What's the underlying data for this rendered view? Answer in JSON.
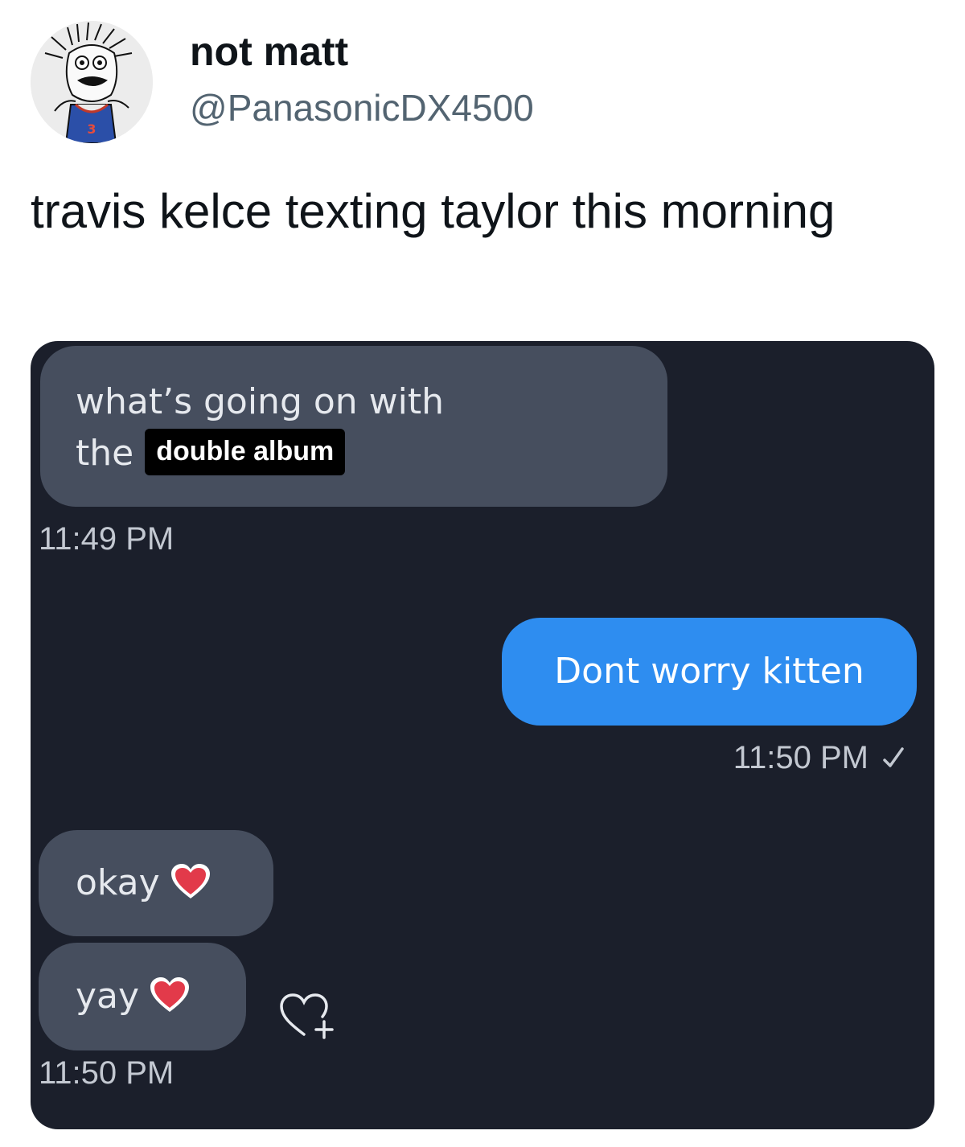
{
  "tweet": {
    "display_name": "not matt",
    "handle": "@PanasonicDX4500",
    "text": "travis kelce texting taylor this morning",
    "avatar_icon": "sketch-avatar-icon"
  },
  "chat": {
    "background": "#1b1f2b",
    "incoming_bubble_color": "#464e5e",
    "outgoing_bubble_color": "#2e8df0",
    "messages": [
      {
        "direction": "incoming",
        "line1": "what’s going on with",
        "line2_prefix": "the",
        "overlay_label": "double album",
        "time": "11:49 PM"
      },
      {
        "direction": "outgoing",
        "text": "Dont worry kitten",
        "time": "11:50 PM",
        "status_icon": "check-icon"
      },
      {
        "direction": "incoming",
        "text": "okay",
        "emoji": "red-heart-icon"
      },
      {
        "direction": "incoming",
        "text": "yay",
        "emoji": "red-heart-icon",
        "time": "11:50 PM",
        "reaction_icon": "add-reaction-heart-icon"
      }
    ]
  }
}
